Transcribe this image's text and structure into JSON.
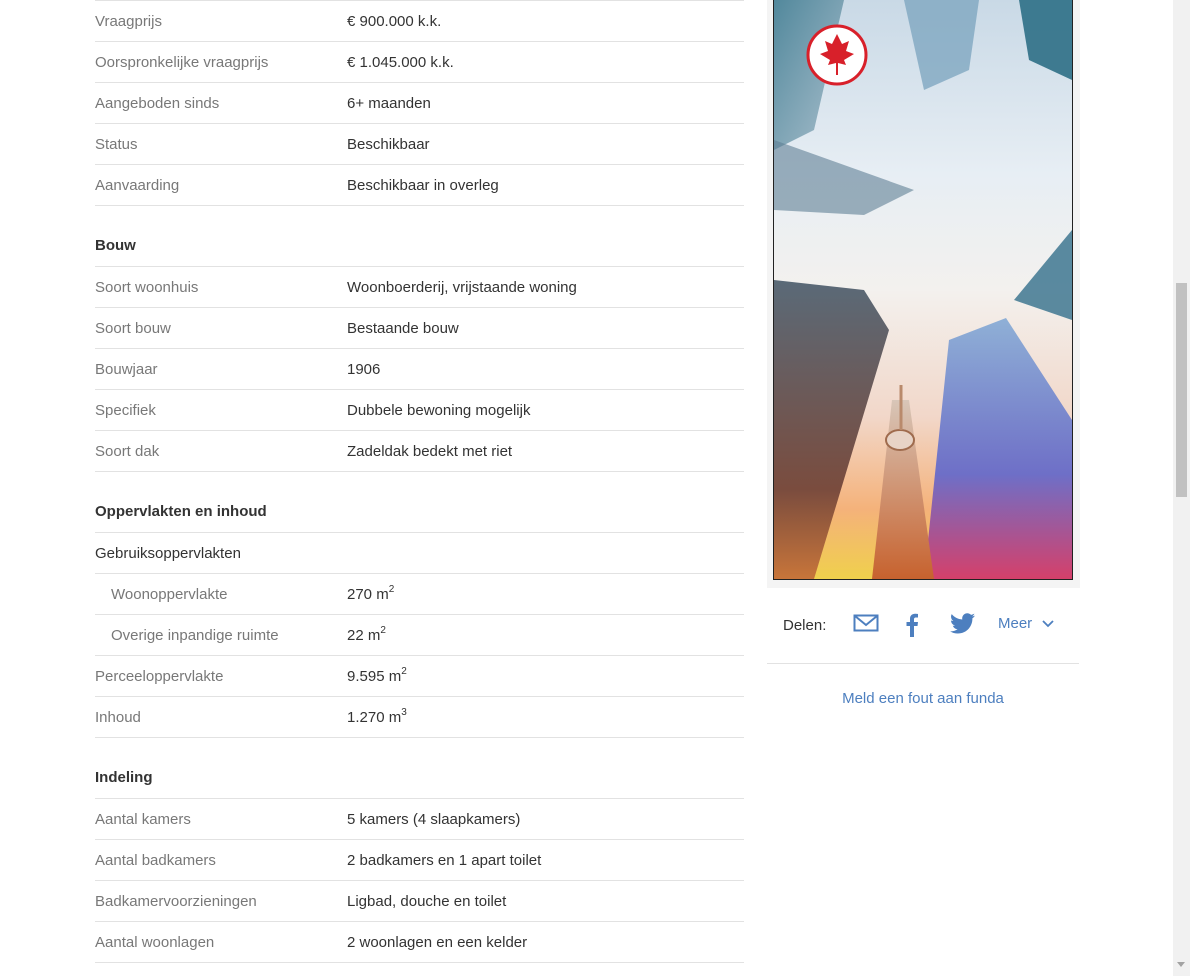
{
  "overdracht": {
    "rows": [
      {
        "label": "Vraagprijs",
        "value": "€ 900.000 k.k."
      },
      {
        "label": "Oorspronkelijke vraagprijs",
        "value": "€ 1.045.000 k.k."
      },
      {
        "label": "Aangeboden sinds",
        "value": "6+ maanden"
      },
      {
        "label": "Status",
        "value": "Beschikbaar"
      },
      {
        "label": "Aanvaarding",
        "value": "Beschikbaar in overleg"
      }
    ]
  },
  "bouw": {
    "title": "Bouw",
    "rows": [
      {
        "label": "Soort woonhuis",
        "value": "Woonboerderij, vrijstaande woning"
      },
      {
        "label": "Soort bouw",
        "value": "Bestaande bouw"
      },
      {
        "label": "Bouwjaar",
        "value": "1906"
      },
      {
        "label": "Specifiek",
        "value": "Dubbele bewoning mogelijk"
      },
      {
        "label": "Soort dak",
        "value": "Zadeldak bedekt met riet"
      }
    ]
  },
  "oppervlakten": {
    "title": "Oppervlakten en inhoud",
    "gebruik_label": "Gebruiksoppervlakten",
    "woon_label": "Woonoppervlakte",
    "woon_value": "270 m",
    "woon_unit": "2",
    "overig_label": "Overige inpandige ruimte",
    "overig_value": "22 m",
    "overig_unit": "2",
    "perceel_label": "Perceeloppervlakte",
    "perceel_value": "9.595 m",
    "perceel_unit": "2",
    "inhoud_label": "Inhoud",
    "inhoud_value": "1.270 m",
    "inhoud_unit": "3"
  },
  "indeling": {
    "title": "Indeling",
    "rows": [
      {
        "label": "Aantal kamers",
        "value": "5 kamers (4 slaapkamers)"
      },
      {
        "label": "Aantal badkamers",
        "value": "2 badkamers en 1 apart toilet"
      },
      {
        "label": "Badkamervoorzieningen",
        "value": "Ligbad, douche en toilet"
      },
      {
        "label": "Aantal woonlagen",
        "value": "2 woonlagen en een kelder"
      }
    ]
  },
  "share": {
    "label": "Delen:",
    "icons": [
      "mail-icon",
      "facebook-icon",
      "twitter-icon"
    ],
    "more_label": "Meer",
    "accent": "#4d7fbf"
  },
  "report_link": "Meld een fout aan funda",
  "ad": {
    "logo": "maple-leaf-logo",
    "brand_color": "#d8202a"
  }
}
